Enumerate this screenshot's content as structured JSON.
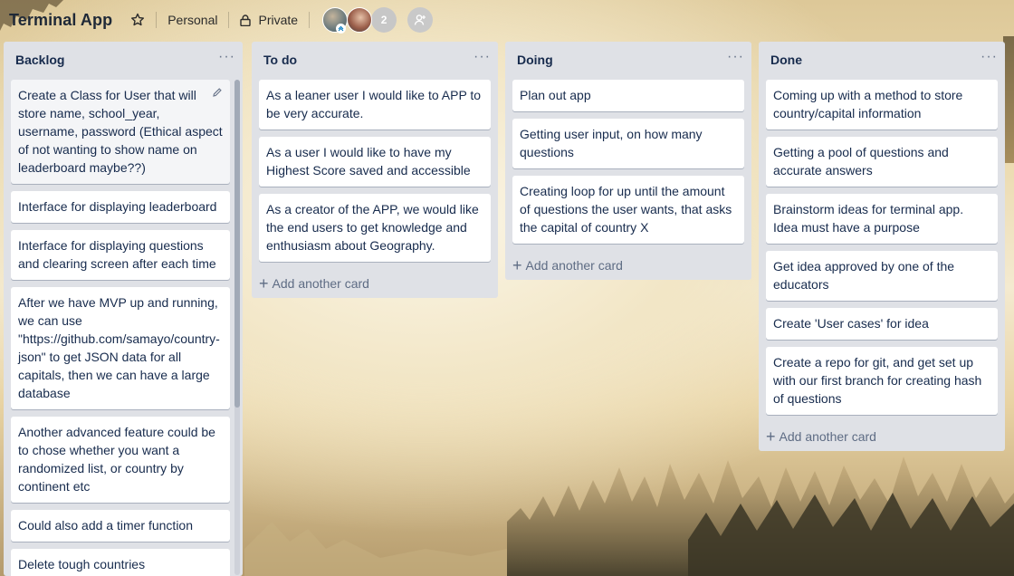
{
  "board": {
    "title": "Terminal App",
    "team": "Personal",
    "visibility": "Private",
    "member_count": "2"
  },
  "lists": [
    {
      "title": "Backlog",
      "cards": [
        "Create a Class for User that will store name, school_year, username, password (Ethical aspect of not wanting to show name on leaderboard maybe??)",
        "Interface for displaying leaderboard",
        "Interface for displaying questions and clearing screen after each time",
        "After we have MVP up and running, we can use \"https://github.com/samayo/country-json\" to get JSON data for all capitals, then we can have a large database",
        "Another advanced feature could be to chose whether you want a randomized list, or country by continent etc",
        "Could also add a timer function",
        "Delete tough countries"
      ]
    },
    {
      "title": "To do",
      "cards": [
        "As a leaner user I would like to APP to be very accurate.",
        "As a user I would like to have my Highest Score saved and accessible",
        "As a creator of the APP, we would like the end users to get knowledge and enthusiasm about Geography."
      ],
      "add_label": "Add another card"
    },
    {
      "title": "Doing",
      "cards": [
        "Plan out app",
        "Getting user input, on how many questions",
        "Creating loop for up until the amount of questions the user wants, that asks the capital of country X"
      ],
      "add_label": "Add another card"
    },
    {
      "title": "Done",
      "cards": [
        "Coming up with a method to store country/capital information",
        "Getting a pool of questions and accurate answers",
        "Brainstorm ideas for terminal app. Idea must have a purpose",
        "Get idea approved by one of the educators",
        "Create 'User cases' for idea",
        "Create a repo for git, and get set up with our first branch for creating hash of questions"
      ],
      "add_label": "Add another card"
    }
  ],
  "icons": {
    "star": "star-icon",
    "lock": "lock-icon",
    "menu": "more-horizontal-icon",
    "plus": "plus-icon",
    "pencil": "pencil-icon",
    "invite": "add-member-icon"
  }
}
